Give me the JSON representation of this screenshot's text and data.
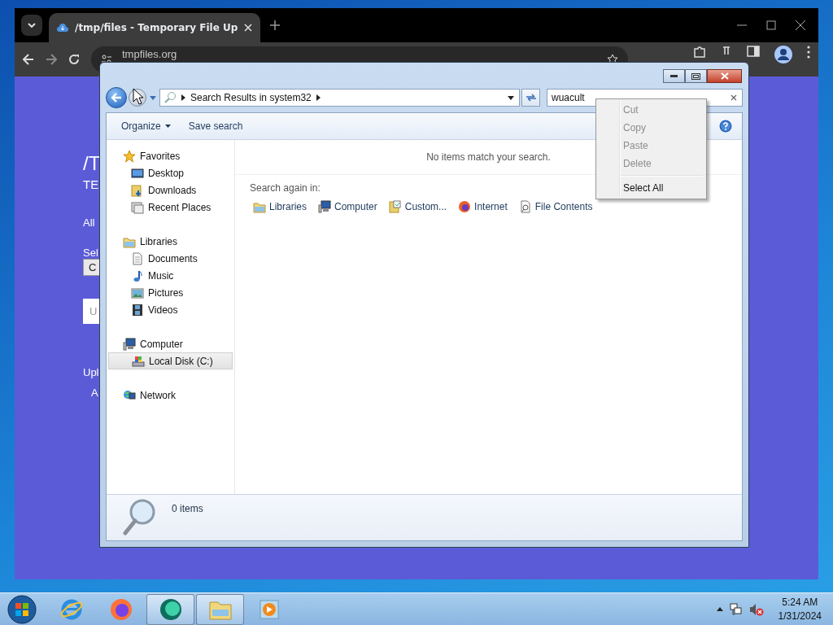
{
  "browser": {
    "tabs": [
      {
        "title": "/tmp/files - Temporary File Up",
        "selected": true
      }
    ],
    "address": "tmpfiles.org",
    "page": [
      {
        "kind": "heading",
        "text": "/T"
      },
      {
        "kind": "subtitle",
        "text": "TE"
      },
      {
        "kind": "text",
        "text": "All"
      },
      {
        "kind": "label",
        "text": "Sel"
      },
      {
        "kind": "button",
        "text": "C"
      },
      {
        "kind": "panel",
        "text": "U"
      },
      {
        "kind": "text",
        "text": "Upl"
      },
      {
        "kind": "indent",
        "text": "A"
      }
    ]
  },
  "explorer": {
    "breadcrumb": [
      "Search Results in system32"
    ],
    "search": {
      "value": "wuacult"
    },
    "commands": [
      {
        "label": "Organize",
        "kind": "menu"
      },
      {
        "label": "Save search",
        "kind": "plain"
      }
    ],
    "nav": [
      {
        "label": "Favorites",
        "kind": "favorites",
        "selected": false,
        "children": [
          {
            "label": "Desktop",
            "kind": "desktop",
            "selected": false
          },
          {
            "label": "Downloads",
            "kind": "downloads",
            "selected": false
          },
          {
            "label": "Recent Places",
            "kind": "recent",
            "selected": false
          }
        ]
      },
      {
        "label": "Libraries",
        "kind": "libraries",
        "selected": false,
        "children": [
          {
            "label": "Documents",
            "kind": "documents",
            "selected": false
          },
          {
            "label": "Music",
            "kind": "music",
            "selected": false
          },
          {
            "label": "Pictures",
            "kind": "pictures",
            "selected": false
          },
          {
            "label": "Videos",
            "kind": "videos",
            "selected": false
          }
        ]
      },
      {
        "label": "Computer",
        "kind": "computer",
        "selected": false,
        "children": [
          {
            "label": "Local Disk (C:)",
            "kind": "disk",
            "selected": true
          }
        ]
      },
      {
        "label": "Network",
        "kind": "network",
        "selected": false
      }
    ],
    "message": "No items match your search.",
    "search_again_label": "Search again in:",
    "search_again": [
      {
        "label": "Libraries",
        "kind": "libraries"
      },
      {
        "label": "Computer",
        "kind": "computer"
      },
      {
        "label": "Custom...",
        "kind": "custom"
      },
      {
        "label": "Internet",
        "kind": "internet"
      },
      {
        "label": "File Contents",
        "kind": "contents"
      }
    ],
    "status": "0 items"
  },
  "context_menu": [
    {
      "kind": "item",
      "label": "Cut",
      "disabled": true
    },
    {
      "kind": "item",
      "label": "Copy",
      "disabled": true
    },
    {
      "kind": "item",
      "label": "Paste",
      "disabled": true
    },
    {
      "kind": "item",
      "label": "Delete",
      "disabled": true
    },
    {
      "kind": "separator"
    },
    {
      "kind": "item",
      "label": "Select All",
      "disabled": false
    }
  ],
  "taskbar": {
    "apps": [
      {
        "kind": "ie",
        "active": false
      },
      {
        "kind": "firefox",
        "active": false
      },
      {
        "kind": "chat",
        "active": true
      },
      {
        "kind": "explorer",
        "active": true
      },
      {
        "kind": "media",
        "active": false
      }
    ],
    "time": "5:24 AM",
    "date": "1/31/2024"
  }
}
